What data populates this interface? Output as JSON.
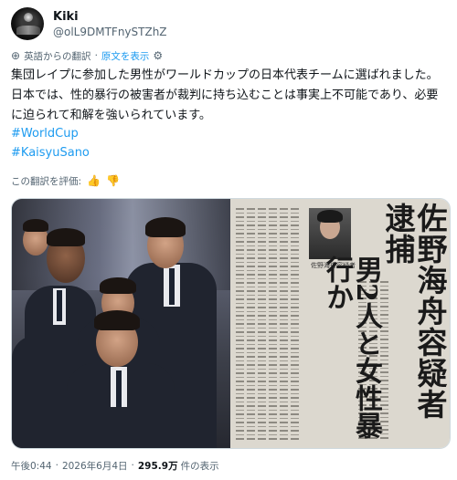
{
  "author": {
    "display_name": "Kiki",
    "handle": "@olL9DMTFnySTZhZ"
  },
  "translation": {
    "label": "英語からの翻訳",
    "separator": "·",
    "show_original": "原文を表示"
  },
  "post": {
    "text": "集団レイプに参加した男性がワールドカップの日本代表チームに選ばれました。日本では、性的暴行の被害者が裁判に持ち込むことは事実上不可能であり、必要に迫られて和解を強いられています。",
    "hashtags": [
      "#WorldCup",
      "#KaisyuSano"
    ]
  },
  "rate_translation": {
    "label": "この翻訳を評価:"
  },
  "newspaper": {
    "headline": "佐野海舟容疑者　逮捕",
    "subhead": "男2人と女性暴行か",
    "portrait_caption": "佐野海舟容疑者"
  },
  "footer": {
    "time": "午後0:44",
    "separator": "·",
    "date": "2026年6月4日",
    "views_count": "295.9万",
    "views_label": "件の表示"
  },
  "icons": {
    "translate": "translate-icon",
    "gear": "gear-icon",
    "thumbs_up": "thumbs-up-icon",
    "thumbs_down": "thumbs-down-icon"
  },
  "colors": {
    "accent": "#1d9bf0",
    "secondary_text": "#536471",
    "primary_text": "#0f1419"
  }
}
